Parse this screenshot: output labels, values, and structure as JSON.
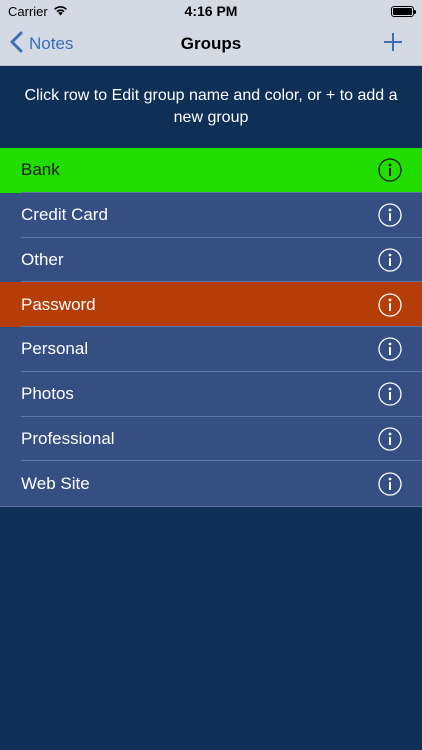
{
  "status_bar": {
    "carrier": "Carrier",
    "time": "4:16 PM"
  },
  "nav": {
    "back_label": "Notes",
    "title": "Groups",
    "add_icon": "plus-icon"
  },
  "instructions": "Click row to Edit group name and color, or + to add a new group",
  "groups": [
    {
      "label": "Bank",
      "color": "#22dd00",
      "text_color": "#1a1a1a"
    },
    {
      "label": "Credit Card",
      "color": "#364f82",
      "text_color": "#ffffff"
    },
    {
      "label": "Other",
      "color": "#364f82",
      "text_color": "#ffffff"
    },
    {
      "label": "Password",
      "color": "#b53d08",
      "text_color": "#ffffff"
    },
    {
      "label": "Personal",
      "color": "#364f82",
      "text_color": "#ffffff"
    },
    {
      "label": "Photos",
      "color": "#364f82",
      "text_color": "#ffffff"
    },
    {
      "label": "Professional",
      "color": "#364f82",
      "text_color": "#ffffff"
    },
    {
      "label": "Web Site",
      "color": "#364f82",
      "text_color": "#ffffff"
    }
  ],
  "colors": {
    "background": "#0f2f57",
    "nav_background": "#d3dae4",
    "tint": "#3a6fb7",
    "row_default": "#364f82"
  }
}
